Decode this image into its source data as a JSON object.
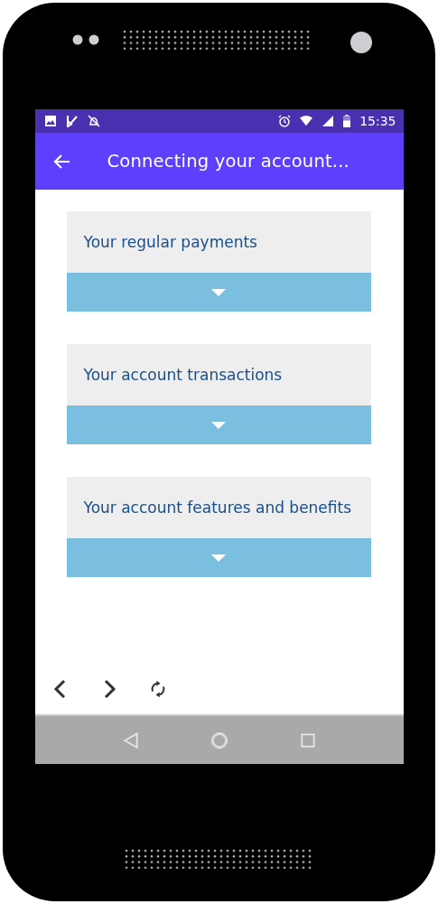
{
  "status_bar": {
    "time": "15:35"
  },
  "app_bar": {
    "title": "Connecting your account..."
  },
  "sections": [
    {
      "title": "Your regular payments",
      "expanded": false
    },
    {
      "title": "Your account transactions",
      "expanded": false
    },
    {
      "title": "Your account features and benefits",
      "expanded": false
    }
  ]
}
